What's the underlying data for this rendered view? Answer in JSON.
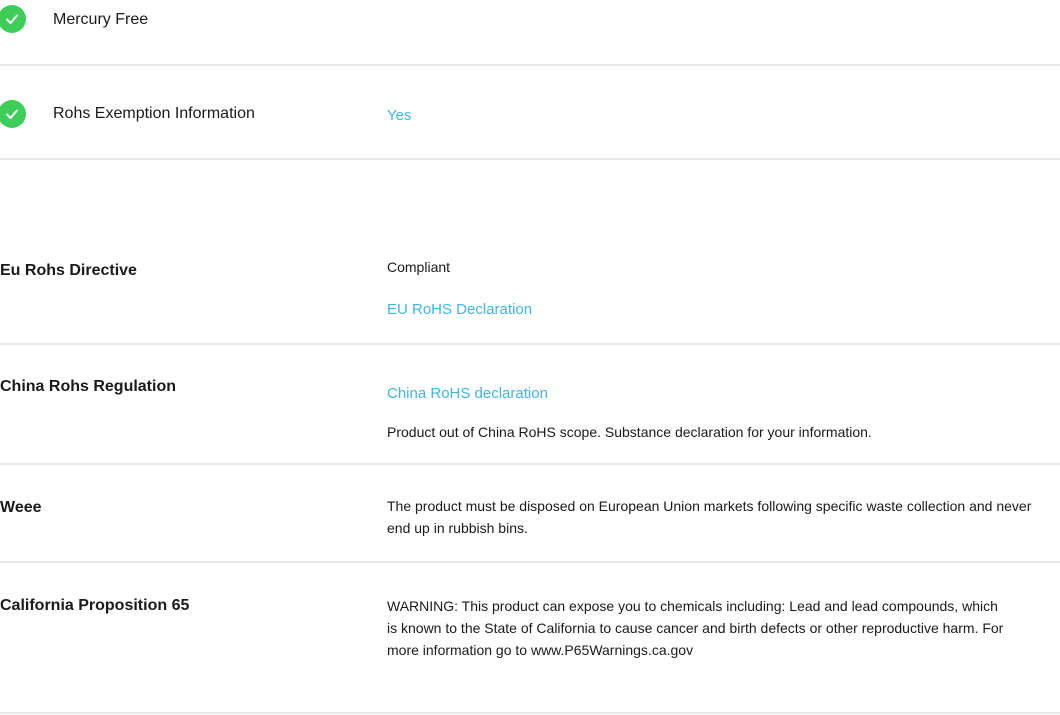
{
  "features": [
    {
      "label": "Mercury Free",
      "value": ""
    },
    {
      "label": "Rohs Exemption Information",
      "value": "Yes"
    }
  ],
  "sections": {
    "eu_rohs": {
      "label": "Eu Rohs Directive",
      "status": "Compliant",
      "link": "EU RoHS Declaration"
    },
    "china_rohs": {
      "label": "China Rohs Regulation",
      "link": "China RoHS declaration",
      "note": "Product out of China RoHS scope. Substance declaration for your information."
    },
    "weee": {
      "label": "Weee",
      "text": "The product must be disposed on European Union markets following specific waste collection and never end up in rubbish bins."
    },
    "prop65": {
      "label": "California Proposition 65",
      "text": "WARNING: This product can expose you to chemicals including: Lead and lead compounds, which is known to the State of California to cause cancer and birth defects or other reproductive harm. For more information go to www.P65Warnings.ca.gov"
    }
  },
  "colors": {
    "check": "#3dcd58",
    "link": "#42b4e6",
    "divider": "#e8e8e8"
  }
}
